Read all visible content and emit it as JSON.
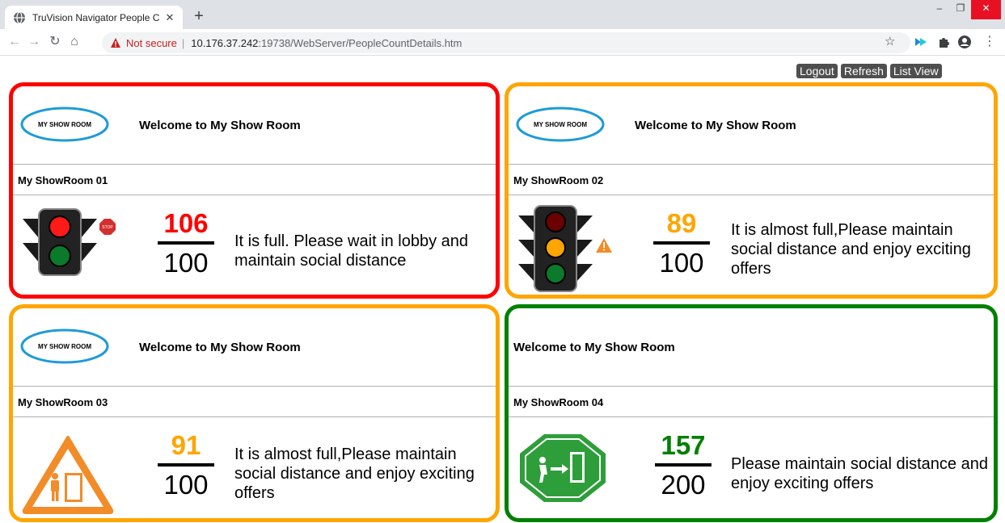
{
  "browser": {
    "tab_title": "TruVision Navigator People Cour",
    "url_security": "Not secure",
    "url_host": "10.176.37.242",
    "url_rest": ":19738/WebServer/PeopleCountDetails.htm"
  },
  "actions": {
    "logout": "Logout",
    "refresh": "Refresh",
    "list_view": "List View"
  },
  "colors": {
    "red": "#ff0000",
    "orange": "#ffa500",
    "green": "#008000",
    "logo_blue": "#1e9bd7"
  },
  "logo_text": "MY SHOW ROOM",
  "rooms": [
    {
      "welcome": "Welcome to My Show Room",
      "name": "My ShowRoom 01",
      "count": "106",
      "capacity": "100",
      "status": "red",
      "sign": "traffic-light-red",
      "message": "It is full. Please wait in lobby and maintain social distance"
    },
    {
      "welcome": "Welcome to My Show Room",
      "name": "My ShowRoom 02",
      "count": "89",
      "capacity": "100",
      "status": "orange",
      "sign": "traffic-light-amber",
      "message": "It is almost full,Please maintain social distance and enjoy exciting offers"
    },
    {
      "welcome": "Welcome to My Show Room",
      "name": "My ShowRoom 03",
      "count": "91",
      "capacity": "100",
      "status": "orange",
      "sign": "warning-entry-sign",
      "message": "It is almost full,Please maintain social distance and enjoy exciting offers"
    },
    {
      "welcome": "Welcome to My Show Room",
      "name": "My ShowRoom 04",
      "count": "157",
      "capacity": "200",
      "status": "green",
      "sign": "green-enter-sign",
      "message": "Please maintain social distance and enjoy exciting offers"
    }
  ]
}
